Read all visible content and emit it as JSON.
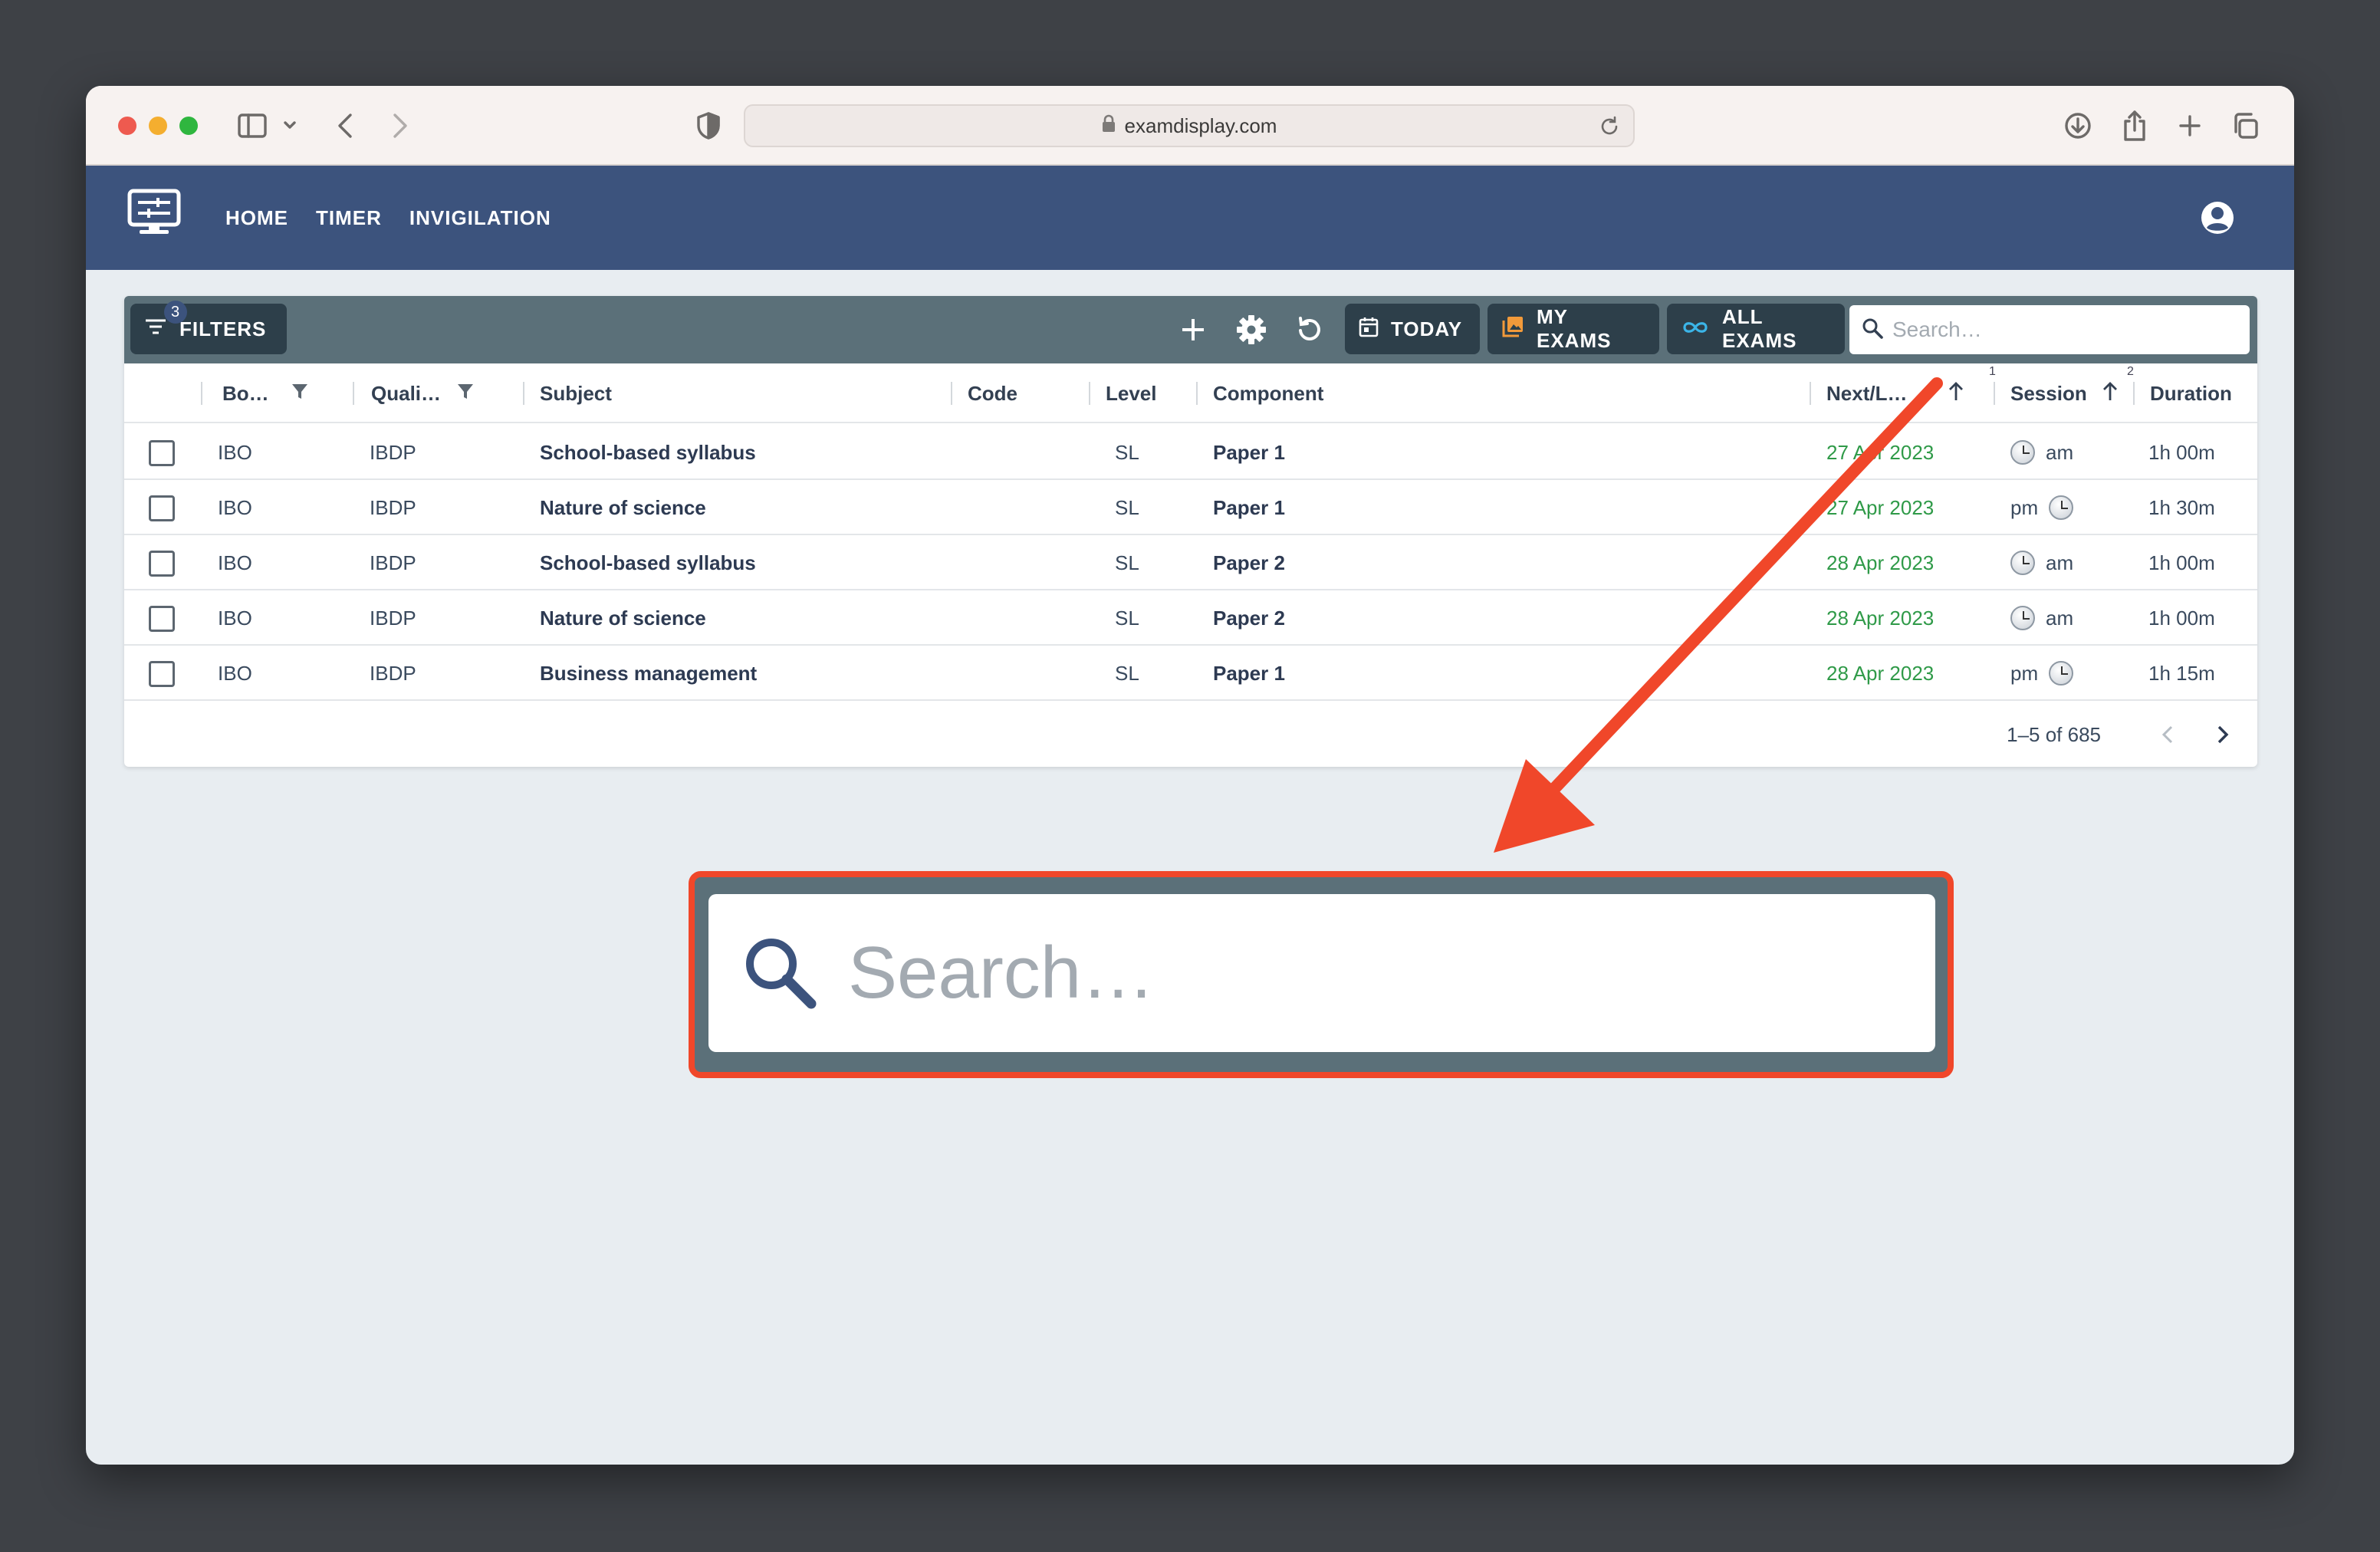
{
  "browser": {
    "url": "examdisplay.com"
  },
  "nav": {
    "items": [
      "HOME",
      "TIMER",
      "INVIGILATION"
    ]
  },
  "toolbar": {
    "filters_label": "FILTERS",
    "filters_count": "3",
    "today_label": "TODAY",
    "my_exams_label": "MY EXAMS",
    "all_exams_label": "ALL EXAMS",
    "search_placeholder": "Search…"
  },
  "table": {
    "columns": {
      "board": "Bo…",
      "qualification": "Quali…",
      "subject": "Subject",
      "code": "Code",
      "level": "Level",
      "component": "Component",
      "next": "Next/L…",
      "session": "Session",
      "duration": "Duration"
    },
    "sort_order": {
      "next": "1",
      "session": "2"
    },
    "rows": [
      {
        "board": "IBO",
        "qualification": "IBDP",
        "subject": "School-based syllabus",
        "code": "",
        "level": "SL",
        "component": "Paper 1",
        "date": "27 Apr 2023",
        "session": "am",
        "duration": "1h 00m"
      },
      {
        "board": "IBO",
        "qualification": "IBDP",
        "subject": "Nature of science",
        "code": "",
        "level": "SL",
        "component": "Paper 1",
        "date": "27 Apr 2023",
        "session": "pm",
        "duration": "1h 30m"
      },
      {
        "board": "IBO",
        "qualification": "IBDP",
        "subject": "School-based syllabus",
        "code": "",
        "level": "SL",
        "component": "Paper 2",
        "date": "28 Apr 2023",
        "session": "am",
        "duration": "1h 00m"
      },
      {
        "board": "IBO",
        "qualification": "IBDP",
        "subject": "Nature of science",
        "code": "",
        "level": "SL",
        "component": "Paper 2",
        "date": "28 Apr 2023",
        "session": "am",
        "duration": "1h 00m"
      },
      {
        "board": "IBO",
        "qualification": "IBDP",
        "subject": "Business management",
        "code": "",
        "level": "SL",
        "component": "Paper 1",
        "date": "28 Apr 2023",
        "session": "pm",
        "duration": "1h 15m"
      }
    ],
    "pagination": "1–5 of 685"
  },
  "callout": {
    "search_placeholder": "Search…"
  },
  "colors": {
    "appbar": "#3c537d",
    "toolbar": "#5b7079",
    "date_green": "#2f9a48",
    "highlight": "#f0472a"
  }
}
